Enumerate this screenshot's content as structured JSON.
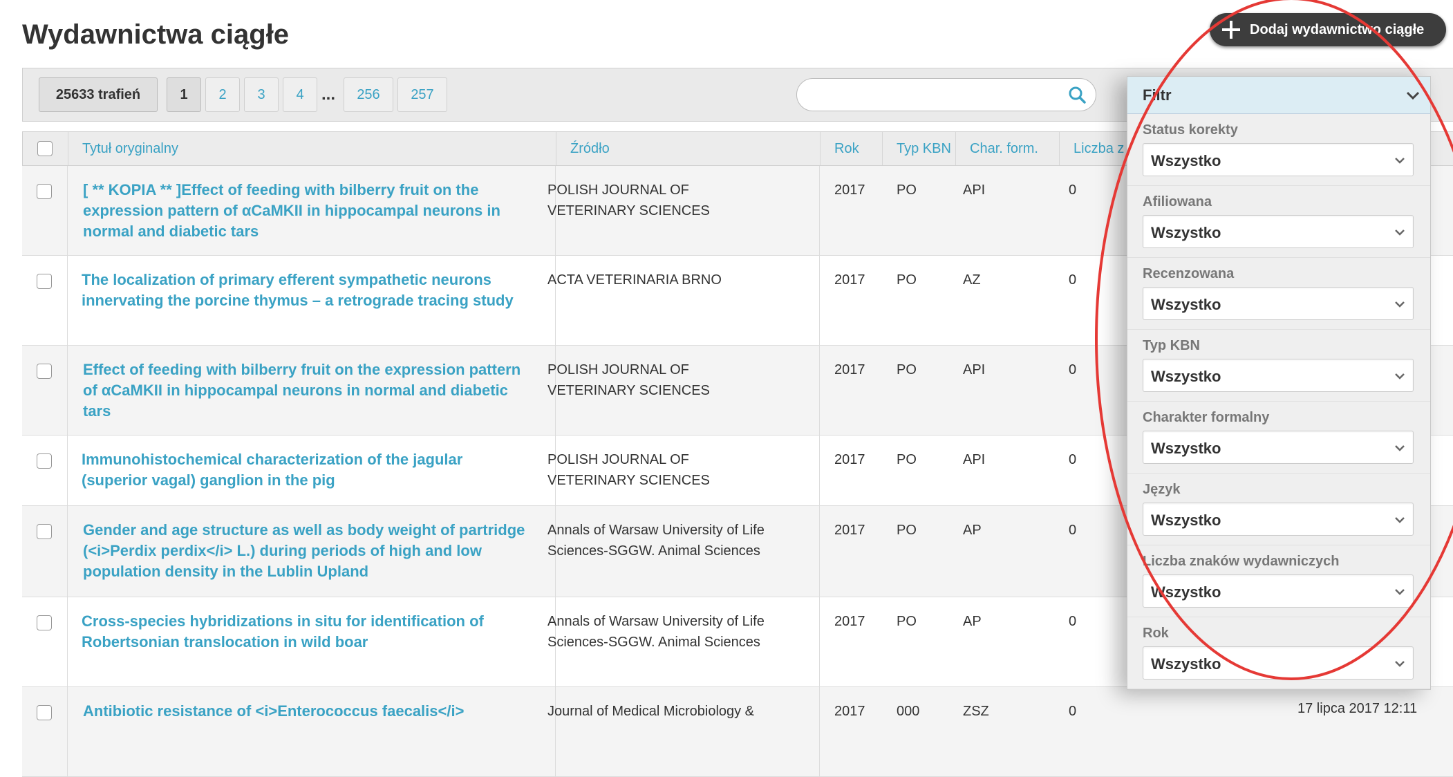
{
  "page": {
    "title": "Wydawnictwa ciągłe",
    "add_button_label": "Dodaj wydawnictwo ciągłe"
  },
  "toolbar": {
    "hits_label": "25633 trafień",
    "pages": [
      "1",
      "2",
      "3",
      "4"
    ],
    "ellipsis": "...",
    "last_pages": [
      "256",
      "257"
    ],
    "search_value": ""
  },
  "table": {
    "columns": [
      "Tytuł oryginalny",
      "Źródło",
      "Rok",
      "Typ KBN",
      "Char. form.",
      "Liczba z"
    ],
    "rows": [
      {
        "title": "[ ** KOPIA ** ]Effect of feeding with bilberry fruit on the expression pattern of αCaMKII in hippocampal neurons in normal and diabetic tars",
        "source": "POLISH JOURNAL OF VETERINARY SCIENCES",
        "year": "2017",
        "kbn": "PO",
        "char": "API",
        "count": "0",
        "date": ""
      },
      {
        "title": "The localization of primary efferent sympathetic neurons innervating the porcine thymus – a retrograde tracing study",
        "source": "ACTA VETERINARIA BRNO",
        "year": "2017",
        "kbn": "PO",
        "char": "AZ",
        "count": "0",
        "date": ""
      },
      {
        "title": "Effect of feeding with bilberry fruit on the expression pattern of αCaMKII in hippocampal neurons in normal and diabetic tars",
        "source": "POLISH JOURNAL OF VETERINARY SCIENCES",
        "year": "2017",
        "kbn": "PO",
        "char": "API",
        "count": "0",
        "date": ""
      },
      {
        "title": "Immunohistochemical characterization of the jagular (superior vagal) ganglion in the pig",
        "source": "POLISH JOURNAL OF VETERINARY SCIENCES",
        "year": "2017",
        "kbn": "PO",
        "char": "API",
        "count": "0",
        "date": ""
      },
      {
        "title": "Gender and age structure as well as body weight of partridge (<i>Perdix perdix</i> L.) during periods of high and low population density in the Lublin Upland",
        "source": "Annals of Warsaw University of Life Sciences-SGGW. Animal Sciences",
        "year": "2017",
        "kbn": "PO",
        "char": "AP",
        "count": "0",
        "date": ""
      },
      {
        "title": "Cross-species hybridizations in situ for identification of Robertsonian translocation in wild boar",
        "source": "Annals of Warsaw University of Life Sciences-SGGW. Animal Sciences",
        "year": "2017",
        "kbn": "PO",
        "char": "AP",
        "count": "0",
        "date": ""
      },
      {
        "title": "Antibiotic resistance of <i>Enterococcus faecalis</i>",
        "source": "Journal of Medical Microbiology &",
        "year": "2017",
        "kbn": "000",
        "char": "ZSZ",
        "count": "0",
        "date": "17 lipca 2017 12:11"
      }
    ]
  },
  "filter": {
    "title": "Filtr",
    "groups": [
      {
        "label": "Status korekty",
        "value": "Wszystko"
      },
      {
        "label": "Afiliowana",
        "value": "Wszystko"
      },
      {
        "label": "Recenzowana",
        "value": "Wszystko"
      },
      {
        "label": "Typ KBN",
        "value": "Wszystko"
      },
      {
        "label": "Charakter formalny",
        "value": "Wszystko"
      },
      {
        "label": "Język",
        "value": "Wszystko"
      },
      {
        "label": "Liczba znaków wydawniczych",
        "value": "Wszystko"
      },
      {
        "label": "Rok",
        "value": "Wszystko"
      }
    ]
  },
  "colors": {
    "link": "#3aa2c4",
    "annotation": "#e53935",
    "button_dark": "#3d3d3d",
    "filter_header": "#dcedf4"
  }
}
